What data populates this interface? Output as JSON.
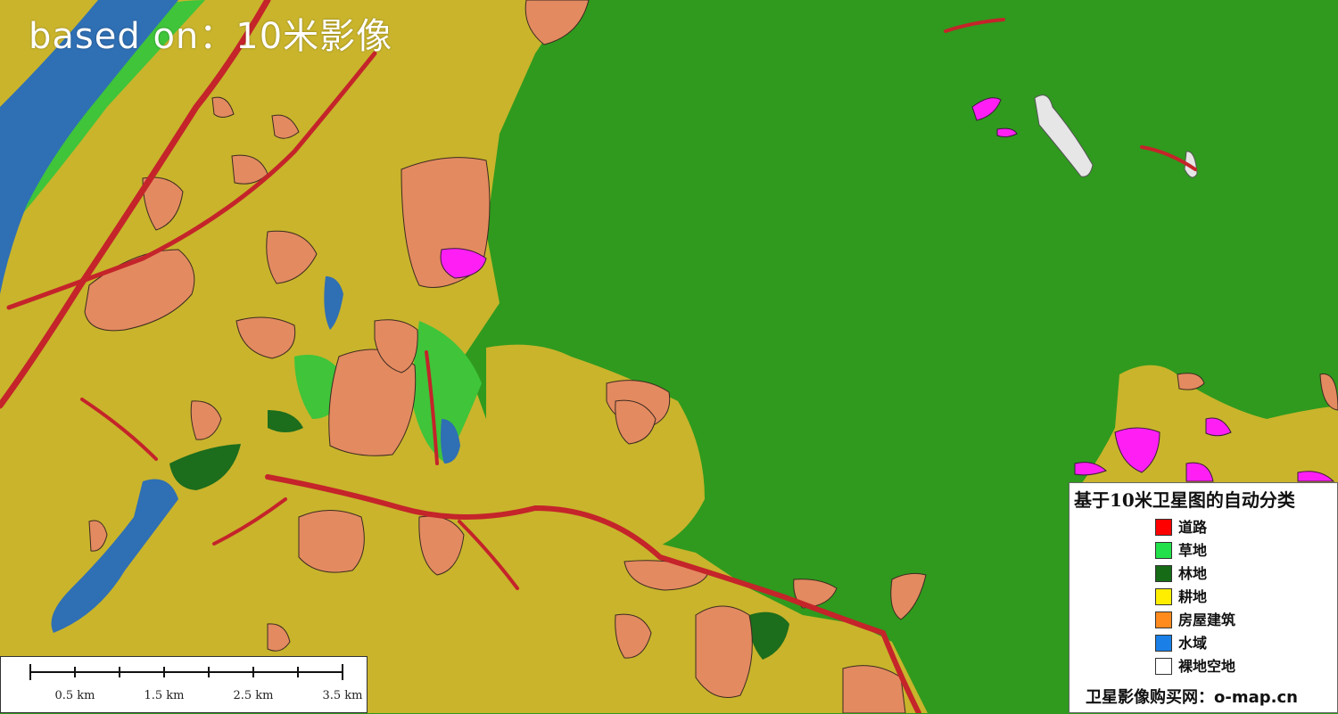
{
  "map": {
    "title_overlay": "based on：10米影像",
    "colors": {
      "forest_base": "#2f9a1e",
      "farmland": "#c8b52a",
      "building": "#e38a60",
      "water": "#2f6fb4",
      "road": "#c4242a",
      "bare": "#e6e6e6",
      "magenta": "#ff1ff5",
      "darkforest": "#1c6d1c"
    }
  },
  "scalebar": {
    "labels": [
      "0.5 km",
      "1.5 km",
      "2.5 km",
      "3.5 km"
    ]
  },
  "legend": {
    "title": "基于10米卫星图的自动分类",
    "items": [
      {
        "label": "道路",
        "color": "#ff0000"
      },
      {
        "label": "草地",
        "color": "#22e04a"
      },
      {
        "label": "林地",
        "color": "#166b16"
      },
      {
        "label": "耕地",
        "color": "#ffee00"
      },
      {
        "label": "房屋建筑",
        "color": "#ff8a1e"
      },
      {
        "label": "水域",
        "color": "#1a7fe6"
      },
      {
        "label": "裸地空地",
        "color": "#ffffff"
      }
    ],
    "credit": "卫星影像购买网：o-map.cn"
  }
}
